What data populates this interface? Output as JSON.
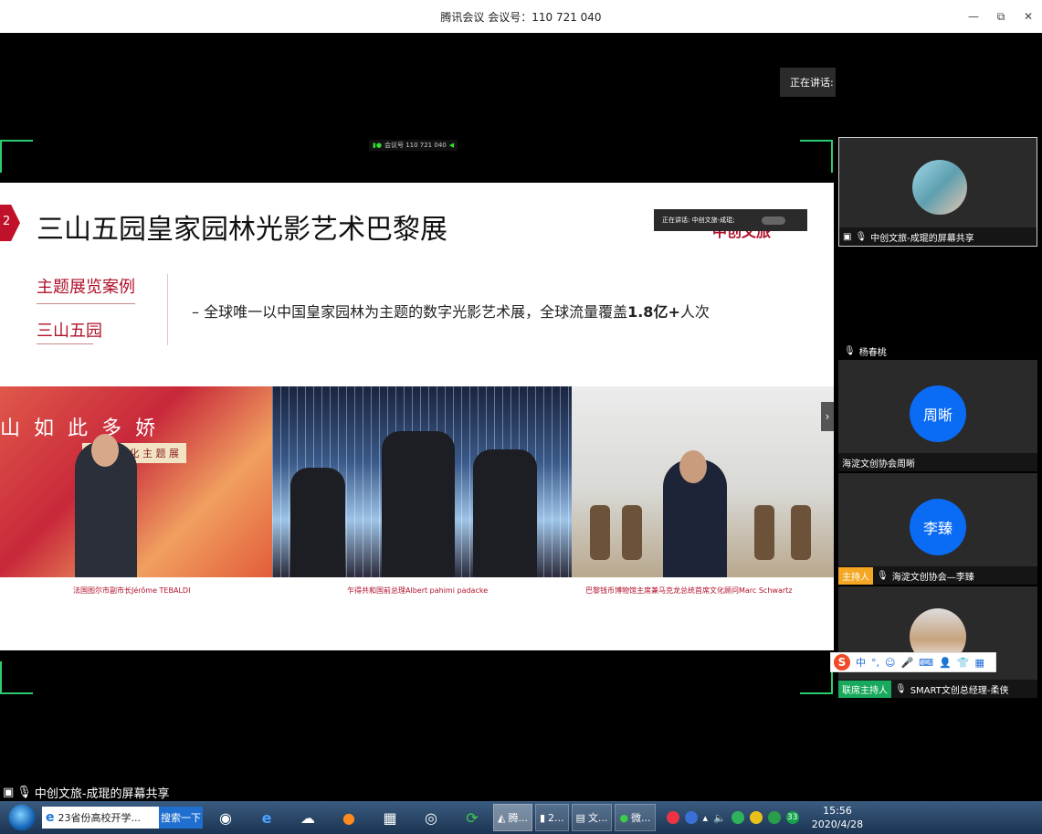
{
  "window": {
    "title": "腾讯会议 会议号：110 721 040",
    "minimize": "—",
    "restore": "⧉",
    "close": "✕"
  },
  "speaking": {
    "label": "正在讲话: 中创文旅-成琨;"
  },
  "mini_meeting": {
    "label": "会议号 110 721 040"
  },
  "slide": {
    "number": "2",
    "title": "三山五园皇家园林光影艺术巴黎展",
    "logo": "中创文旅",
    "speaking_mini": "正在讲话: 中创文旅-成琨;",
    "topic1": "主题展览案例",
    "topic2": "三山五园",
    "desc_prefix": "–  全球唯一以中国皇家园林为主题的数字光影艺术展，全球流量覆盖",
    "desc_bold": "1.8亿+",
    "desc_suffix": "人次",
    "photo1_banner": "山 如 此 多 娇",
    "photo1_sub": "五 园 文 化 主 题 展",
    "captions": [
      "法国图尔市副市长Jérôme TEBALDI",
      "乍得共和国前总理Albert pahimi padacke",
      "巴黎钱币博物馆主席兼马克龙总统首席文化顾问Marc Schwartz"
    ],
    "arrow": "›"
  },
  "participants": {
    "main_tile_label": "中创文旅-成琨的屏幕共享",
    "speaker_name": "杨春桃",
    "tile1": {
      "avatar": "周晰",
      "label": "海淀文创协会周晰"
    },
    "tile2": {
      "avatar": "李臻",
      "badge": "主持人",
      "label": "海淀文创协会—李臻"
    },
    "tile3": {
      "badge": "联席主持人",
      "label": "SMART文创总经理-柔侠"
    }
  },
  "ime": {
    "logo": "S",
    "lang": "中",
    "punct": "°,",
    "items": [
      "☺",
      "🎤",
      "⌨",
      "👤",
      "👕",
      "▦"
    ]
  },
  "share_label": "中创文旅-成琨的屏幕共享",
  "taskbar": {
    "ie_label": "23省份高校开学...",
    "search_btn": "搜索一下",
    "apps": [
      {
        "label": "腾..."
      },
      {
        "label": "2..."
      },
      {
        "label": "文..."
      },
      {
        "label": "微..."
      }
    ],
    "tray_badge": "33",
    "time": "15:56",
    "date": "2020/4/28"
  },
  "colors": {
    "accent_red": "#b0102a",
    "avatar_blue": "#0a6cf5",
    "host_orange": "#f5a623",
    "cohost_green": "#19a95c"
  }
}
